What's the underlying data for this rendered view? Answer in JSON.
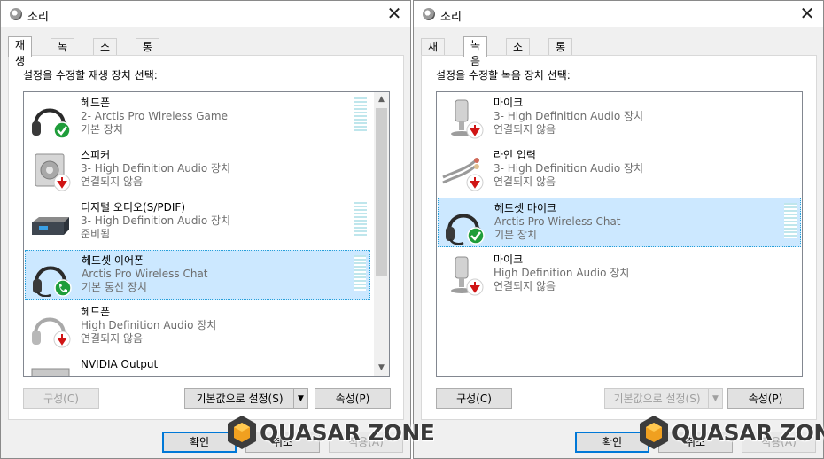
{
  "left_window": {
    "title": "소리",
    "tabs": [
      "재생",
      "녹음",
      "소리",
      "통신"
    ],
    "instruction": "설정을 수정할 재생 장치 선택:",
    "devices": [
      {
        "name": "헤드폰",
        "desc": "2- Arctis Pro Wireless Game",
        "status": "기본 장치",
        "icon": "headphones-icon",
        "badge": "default-check-badge",
        "selected": false,
        "meter": true
      },
      {
        "name": "스피커",
        "desc": "3- High Definition Audio 장치",
        "status": "연결되지 않음",
        "icon": "speaker-icon",
        "badge": "unplugged-arrow-badge",
        "selected": false,
        "meter": false
      },
      {
        "name": "디지털 오디오(S/PDIF)",
        "desc": "3- High Definition Audio 장치",
        "status": "준비됨",
        "icon": "spdif-receiver-icon",
        "badge": "",
        "selected": false,
        "meter": true
      },
      {
        "name": "헤드셋 이어폰",
        "desc": "Arctis Pro Wireless Chat",
        "status": "기본 통신 장치",
        "icon": "headset-icon",
        "badge": "communication-phone-badge",
        "selected": true,
        "meter": true
      },
      {
        "name": "헤드폰",
        "desc": "High Definition Audio 장치",
        "status": "연결되지 않음",
        "icon": "headphones-icon",
        "badge": "unplugged-arrow-badge",
        "selected": false,
        "meter": false
      },
      {
        "name": "NVIDIA Output",
        "desc": "",
        "status": "",
        "icon": "monitor-icon",
        "badge": "",
        "selected": false,
        "meter": false
      }
    ],
    "configure_label": "구성(C)",
    "set_default_label": "기본값으로 설정(S)",
    "properties_label": "속성(P)",
    "ok_label": "확인",
    "cancel_label": "취소",
    "apply_label": "적용(A)"
  },
  "right_window": {
    "title": "소리",
    "tabs": [
      "재생",
      "녹음",
      "소리",
      "통신"
    ],
    "instruction": "설정을 수정할 녹음 장치 선택:",
    "devices": [
      {
        "name": "마이크",
        "desc": "3- High Definition Audio 장치",
        "status": "연결되지 않음",
        "icon": "microphone-icon",
        "badge": "unplugged-arrow-badge",
        "selected": false,
        "meter": false
      },
      {
        "name": "라인 입력",
        "desc": "3- High Definition Audio 장치",
        "status": "연결되지 않음",
        "icon": "line-in-cable-icon",
        "badge": "unplugged-arrow-badge",
        "selected": false,
        "meter": false
      },
      {
        "name": "헤드셋 마이크",
        "desc": "Arctis Pro Wireless Chat",
        "status": "기본 장치",
        "icon": "headset-icon",
        "badge": "default-check-badge",
        "selected": true,
        "meter": true
      },
      {
        "name": "마이크",
        "desc": "High Definition Audio 장치",
        "status": "연결되지 않음",
        "icon": "microphone-icon",
        "badge": "unplugged-arrow-badge",
        "selected": false,
        "meter": false
      }
    ],
    "configure_label": "구성(C)",
    "set_default_label": "기본값으로 설정(S)",
    "properties_label": "속성(P)",
    "ok_label": "확인",
    "cancel_label": "취소",
    "apply_label": "적용(A)"
  },
  "watermark": {
    "text": "QUASAR ZONE"
  }
}
